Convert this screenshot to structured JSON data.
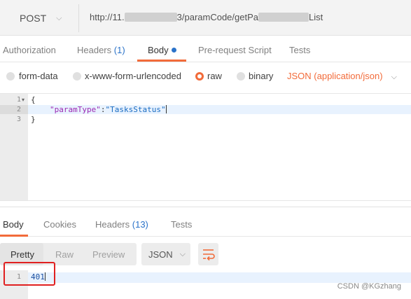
{
  "request": {
    "method": "POST",
    "url_prefix": "http://11.",
    "url_middle": "3/paramCode/getPa",
    "url_suffix": "List"
  },
  "request_tabs": [
    {
      "label": "Authorization"
    },
    {
      "label": "Headers",
      "count": "(1)"
    },
    {
      "label": "Body"
    },
    {
      "label": "Pre-request Script"
    },
    {
      "label": "Tests"
    }
  ],
  "body_options": {
    "form_data": "form-data",
    "urlencoded": "x-www-form-urlencoded",
    "raw": "raw",
    "binary": "binary",
    "content_type": "JSON (application/json)",
    "selected": "raw"
  },
  "editor": {
    "lines": [
      {
        "number": "1",
        "text": "{"
      },
      {
        "number": "2",
        "key": "\"paramType\"",
        "sep": ":",
        "value": "\"TasksStatus\""
      },
      {
        "number": "3",
        "text": "}"
      }
    ]
  },
  "response_tabs": [
    {
      "label": "Body"
    },
    {
      "label": "Cookies"
    },
    {
      "label": "Headers",
      "count": "(13)"
    },
    {
      "label": "Tests"
    }
  ],
  "response_view": {
    "pretty": "Pretty",
    "raw": "Raw",
    "preview": "Preview",
    "format": "JSON"
  },
  "response": {
    "line_number": "1",
    "content": "401"
  },
  "watermark": "CSDN @KGzhang",
  "colors": {
    "accent": "#f26b3a",
    "link_blue": "#2b73c9",
    "highlight_box": "#e02020"
  }
}
